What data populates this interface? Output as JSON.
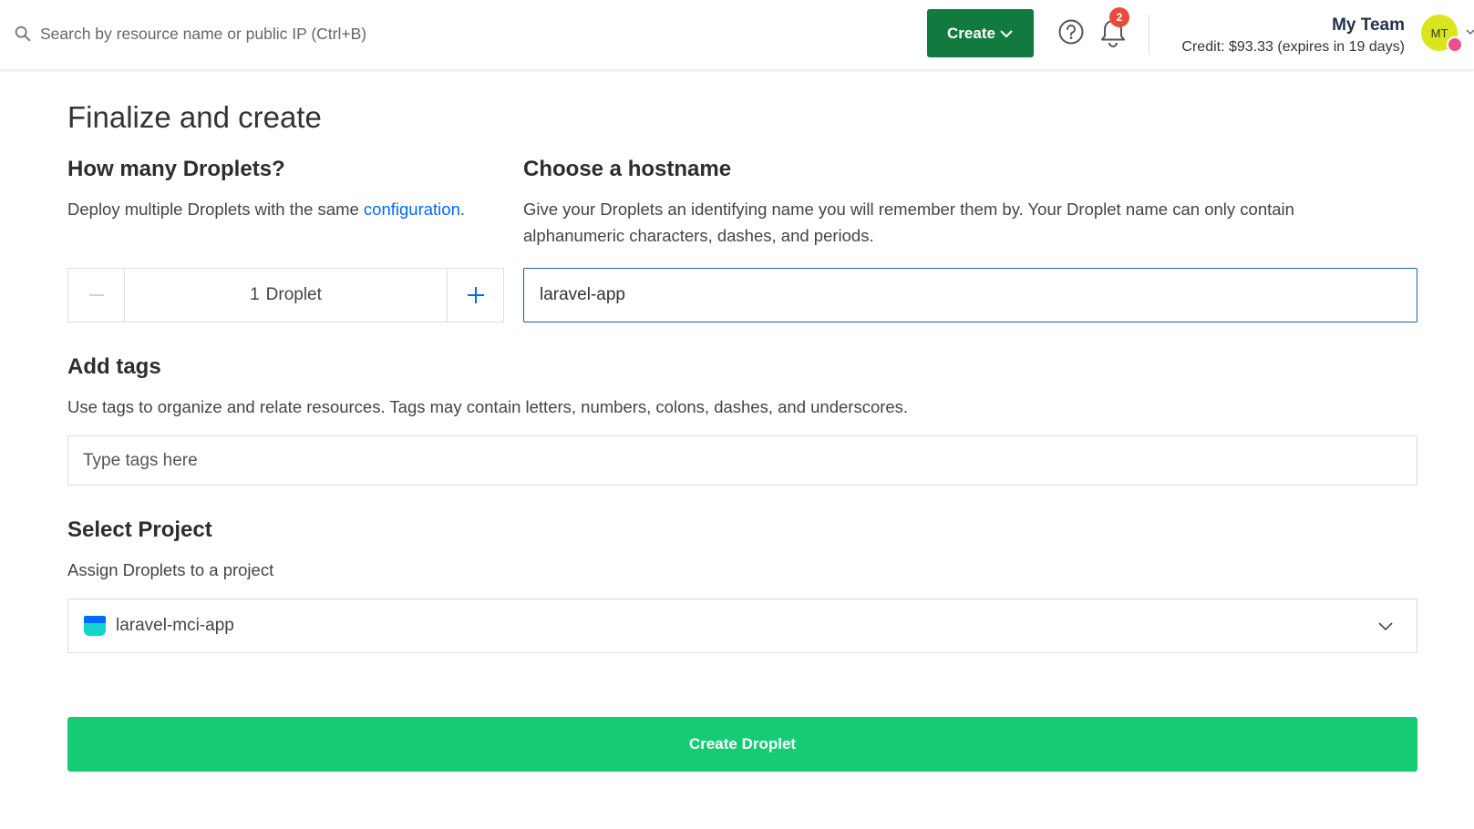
{
  "header": {
    "search_placeholder": "Search by resource name or public IP (Ctrl+B)",
    "create_label": "Create",
    "notifications_count": "2",
    "team_name": "My Team",
    "credit_text": "Credit: $93.33 (expires in 19 days)",
    "avatar_initials": "MT"
  },
  "main": {
    "page_title": "Finalize and create",
    "droplets": {
      "heading": "How many Droplets?",
      "desc_prefix": "Deploy multiple Droplets with the same ",
      "desc_link": "configuration",
      "desc_suffix": ".",
      "count": "1",
      "unit": "Droplet"
    },
    "hostname": {
      "heading": "Choose a hostname",
      "desc": "Give your Droplets an identifying name you will remember them by. Your Droplet name can only contain alphanumeric characters, dashes, and periods.",
      "value": "laravel-app"
    },
    "tags": {
      "heading": "Add tags",
      "desc": "Use tags to organize and relate resources. Tags may contain letters, numbers, colons, dashes, and underscores.",
      "placeholder": "Type tags here"
    },
    "project": {
      "heading": "Select Project",
      "desc": "Assign Droplets to a project",
      "selected": "laravel-mci-app"
    },
    "submit_label": "Create Droplet"
  },
  "colors": {
    "create_button": "#137a3f",
    "submit_button": "#15cc74",
    "link": "#0069ff",
    "badge": "#e84b3c",
    "avatar": "#d9e51f"
  }
}
